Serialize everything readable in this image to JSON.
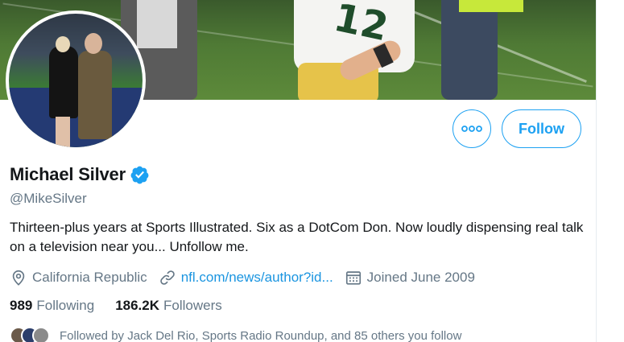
{
  "profile": {
    "name": "Michael Silver",
    "handle": "@MikeSilver",
    "verified": true,
    "bio": "Thirteen-plus years at Sports Illustrated. Six as a DotCom Don. Now loudly dispensing real talk on a television near you... Unfollow me.",
    "location": "California Republic",
    "website": "nfl.com/news/author?id...",
    "joined": "Joined June 2009"
  },
  "stats": {
    "following_count": "989",
    "following_label": "Following",
    "followers_count": "186.2K",
    "followers_label": "Followers"
  },
  "followed_by": "Followed by Jack Del Rio, Sports Radio Roundup, and 85 others you follow",
  "actions": {
    "follow_label": "Follow",
    "more_icon": "more-horizontal-icon"
  },
  "icons": {
    "location": "location-pin-icon",
    "link": "link-icon",
    "calendar": "calendar-icon",
    "verified": "verified-badge-icon"
  },
  "colors": {
    "accent": "#1da1f2",
    "link": "#1b95e0",
    "muted": "#657786",
    "text": "#14171a"
  }
}
